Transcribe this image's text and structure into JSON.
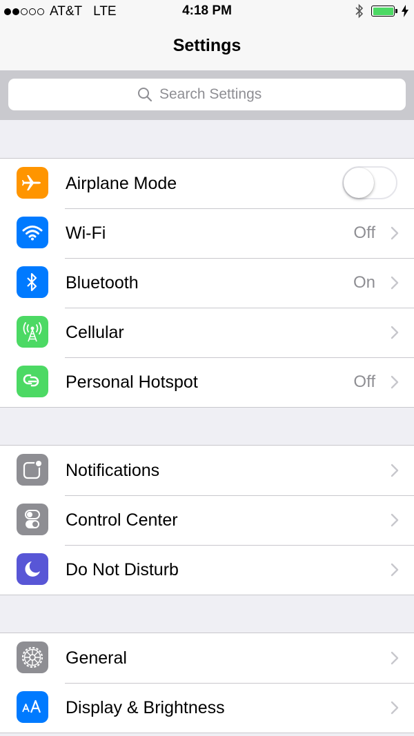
{
  "status_bar": {
    "carrier": "AT&T",
    "network": "LTE",
    "time": "4:18 PM",
    "battery_level": 1.0,
    "signal_bars_filled": 2,
    "signal_bars_total": 5
  },
  "nav": {
    "title": "Settings"
  },
  "search": {
    "placeholder": "Search Settings"
  },
  "colors": {
    "orange": "#ff9500",
    "blue": "#007aff",
    "green": "#4cd964",
    "gray": "#8e8e93",
    "purple": "#5856d6"
  },
  "groups": [
    {
      "rows": [
        {
          "label": "Airplane Mode",
          "icon": "airplane-icon",
          "control": "toggle",
          "on": false
        },
        {
          "label": "Wi-Fi",
          "icon": "wifi-icon",
          "value": "Off"
        },
        {
          "label": "Bluetooth",
          "icon": "bluetooth-icon",
          "value": "On"
        },
        {
          "label": "Cellular",
          "icon": "cellular-antenna-icon",
          "value": ""
        },
        {
          "label": "Personal Hotspot",
          "icon": "hotspot-link-icon",
          "value": "Off"
        }
      ]
    },
    {
      "rows": [
        {
          "label": "Notifications",
          "icon": "notifications-icon"
        },
        {
          "label": "Control Center",
          "icon": "control-center-icon"
        },
        {
          "label": "Do Not Disturb",
          "icon": "moon-icon"
        }
      ]
    },
    {
      "rows": [
        {
          "label": "General",
          "icon": "gear-icon"
        },
        {
          "label": "Display & Brightness",
          "icon": "text-size-icon"
        }
      ]
    }
  ]
}
